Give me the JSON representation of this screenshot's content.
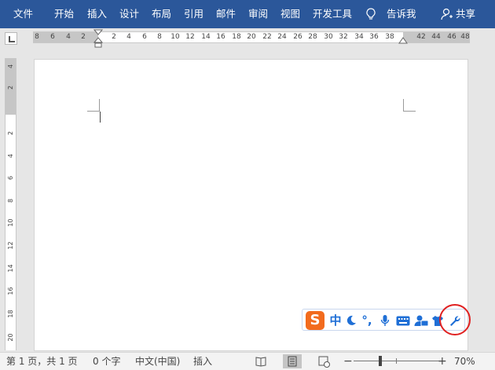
{
  "ribbon": {
    "tabs": [
      "文件",
      "开始",
      "插入",
      "设计",
      "布局",
      "引用",
      "邮件",
      "审阅",
      "视图",
      "开发工具"
    ],
    "tell_me": "告诉我",
    "share": "共享",
    "bg_color": "#2b579a"
  },
  "ruler": {
    "horizontal_numbers": [
      "8",
      "6",
      "4",
      "2",
      "2",
      "4",
      "6",
      "8",
      "10",
      "12",
      "14",
      "16",
      "18",
      "20",
      "22",
      "24",
      "26",
      "28",
      "30",
      "32",
      "34",
      "36",
      "38",
      "42",
      "44",
      "46",
      "48"
    ],
    "vertical_numbers": [
      "4",
      "2",
      "2",
      "4",
      "6",
      "8",
      "10",
      "12",
      "14",
      "16",
      "18",
      "20"
    ]
  },
  "ime_toolbar": {
    "logo": "S",
    "items": [
      {
        "icon": "chinese-mode-icon",
        "glyph": "中"
      },
      {
        "icon": "moon-halfwidth-icon",
        "glyph": "☽"
      },
      {
        "icon": "punctuation-icon",
        "glyph": "°,"
      },
      {
        "icon": "microphone-icon",
        "glyph": "🎤"
      },
      {
        "icon": "keyboard-icon",
        "glyph": "⌨"
      },
      {
        "icon": "user-card-icon",
        "glyph": "👤"
      },
      {
        "icon": "skin-shirt-icon",
        "glyph": "👕"
      },
      {
        "icon": "wrench-icon",
        "glyph": "🔧"
      }
    ],
    "logo_color": "#f26b1d",
    "icon_color": "#1f6fd6",
    "highlight_color": "#e02020"
  },
  "status": {
    "page_info": "第 1 页，共 1 页",
    "word_count": "0 个字",
    "language": "中文(中国)",
    "insert_mode": "插入",
    "zoom_minus": "−",
    "zoom_plus": "+",
    "zoom_level": "70%"
  }
}
